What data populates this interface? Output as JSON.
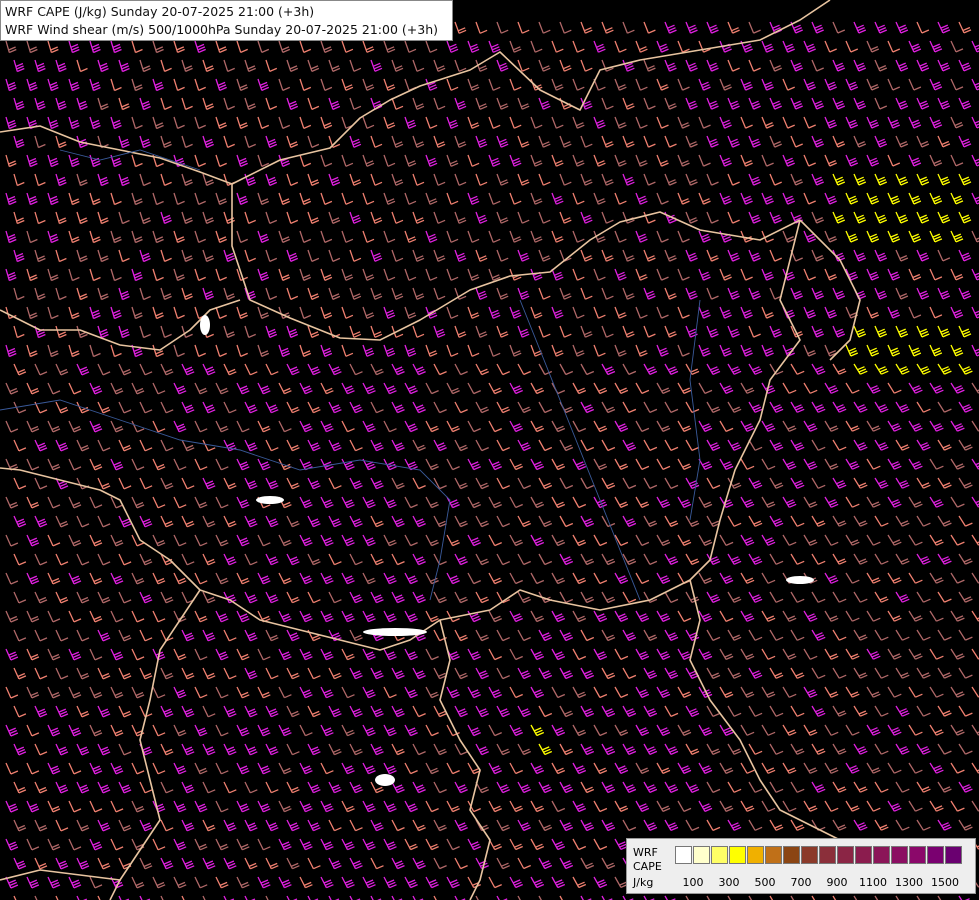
{
  "header": {
    "line1": "WRF CAPE (J/kg) Sunday 20-07-2025 21:00 (+3h)",
    "line2": "WRF Wind shear (m/s) 500/1000hPa Sunday 20-07-2025 21:00 (+3h)"
  },
  "legend": {
    "label1": "WRF",
    "label2": "CAPE",
    "unit": "J/kg",
    "colors": [
      "#ffffff",
      "#ffffcc",
      "#ffff66",
      "#ffff00",
      "#f0b000",
      "#c07018",
      "#8b4513",
      "#8b3a2a",
      "#8b2f3a",
      "#8b2545",
      "#8b1c4e",
      "#8b1558",
      "#8b0e62",
      "#8b086a",
      "#7a0070",
      "#6a0070"
    ],
    "ticks": [
      "100",
      "300",
      "500",
      "700",
      "900",
      "1100",
      "1300",
      "1500"
    ]
  },
  "colors": {
    "background": "#000000",
    "barb_magenta": "#e020e0",
    "barb_salmon": "#f08070",
    "barb_brown": "#b06868",
    "barb_yellow": "#ffff00",
    "border": "#e8c4a0"
  }
}
